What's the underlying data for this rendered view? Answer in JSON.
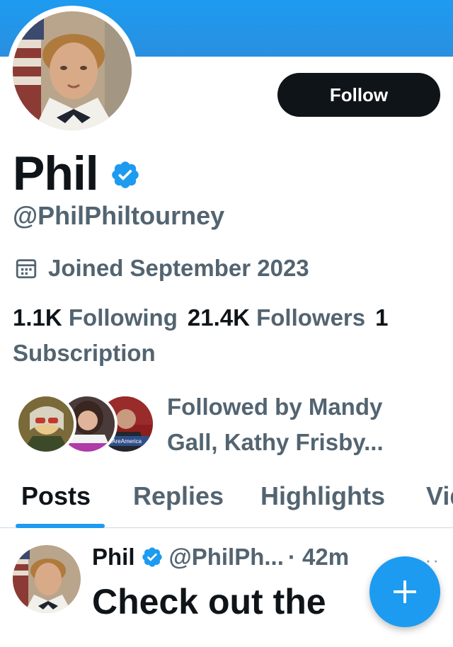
{
  "profile": {
    "display_name": "Phil",
    "handle": "@PhilPhiltourney",
    "joined": "Joined September 2023",
    "follow_label": "Follow",
    "verified": true,
    "accent_color": "#1d9bf0"
  },
  "stats": {
    "following_count": "1.1K",
    "following_label": "Following",
    "followers_count": "21.4K",
    "followers_label": "Followers",
    "subscription_count": "1",
    "subscription_label": "Subscription"
  },
  "followed_by": {
    "text": "Followed by Mandy Gall, Kathy Frisby...",
    "facepile_badge_text": "#WeAreAmerica"
  },
  "tabs": [
    {
      "label": "Posts",
      "active": true
    },
    {
      "label": "Replies",
      "active": false
    },
    {
      "label": "Highlights",
      "active": false
    },
    {
      "label": "Videos",
      "active": false
    }
  ],
  "post": {
    "name": "Phil",
    "handle": "@PhilPh...",
    "time": "· 42m",
    "more": "···",
    "text": "Check out the"
  },
  "icons": {
    "verified": "verified-badge-icon",
    "calendar": "calendar-icon",
    "compose": "plus-icon"
  }
}
